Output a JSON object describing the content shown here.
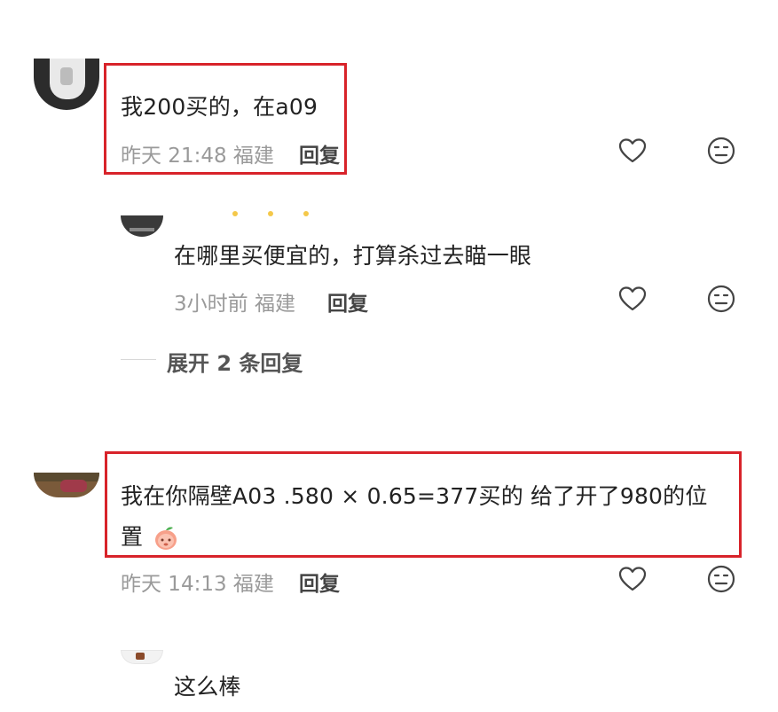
{
  "comments": [
    {
      "text": "我200买的，在a09",
      "time": "昨天 21:48",
      "location": "福建",
      "reply_label": "回复"
    },
    {
      "text": "在哪里买便宜的，打算杀过去瞄一眼",
      "time": "3小时前",
      "location": "福建",
      "reply_label": "回复"
    },
    {
      "text_line1": "我在你隔壁A03  .580 × 0.65=377买的 给了开了980的位",
      "text_line2": "置",
      "time": "昨天 14:13",
      "location": "福建",
      "reply_label": "回复"
    },
    {
      "text": "这么棒"
    }
  ],
  "expand_replies_label": "展开 2 条回复",
  "icons": {
    "like": "heart-outline-icon",
    "dislike": "meh-face-icon",
    "emoji": "peach-emoji-icon"
  },
  "colors": {
    "highlight": "#d8232a",
    "meta_text": "#9a9a9a"
  }
}
